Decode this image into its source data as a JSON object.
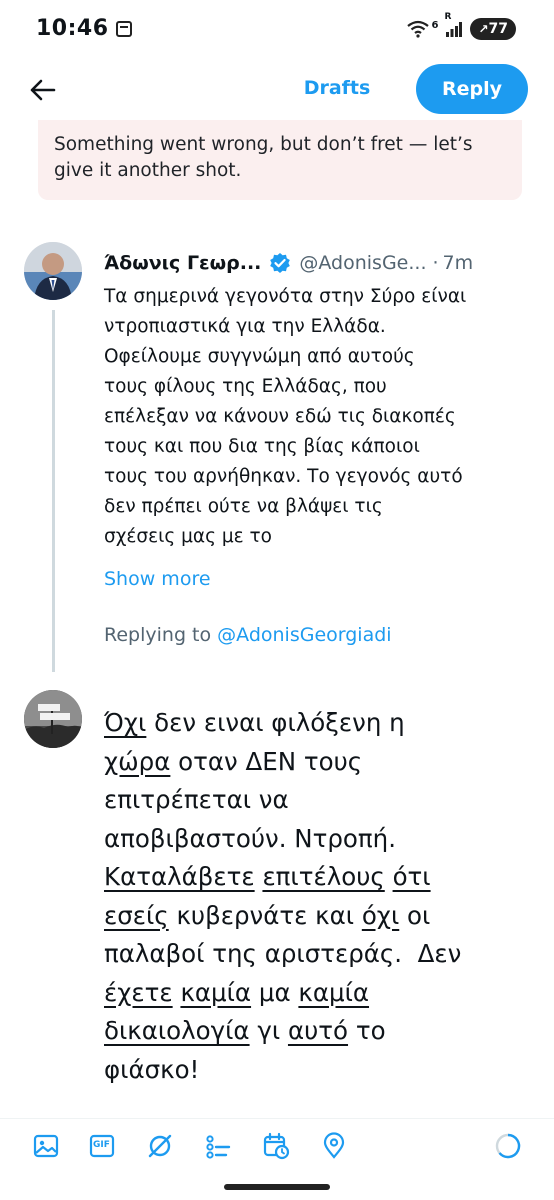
{
  "status_bar": {
    "time": "10:46",
    "battery": "77",
    "network": "6",
    "roaming": "R"
  },
  "top_bar": {
    "drafts_label": "Drafts",
    "reply_label": "Reply"
  },
  "error_banner": {
    "text": "Something went wrong, but don’t fret — let’s give it another shot."
  },
  "tweet": {
    "author_name": "Άδωνις Γεωρ...",
    "handle": "@AdonisGe...",
    "separator": "·",
    "time": "7m",
    "lines": [
      "Τα σημερινά γεγονότα στην Σύρο είναι",
      "ντροπιαστικά για την Ελλάδα.",
      "Οφείλουμε συγγνώμη από αυτούς",
      "τους φίλους της Ελλάδας, που",
      "επέλεξαν να κάνουν εδώ τις διακοπές",
      "τους και που δια της βίας κάποιοι",
      "τους του αρνήθηκαν. Το γεγονός αυτό",
      "δεν πρέπει ούτε να βλάψει τις",
      "σχέσεις μας με το"
    ],
    "show_more": "Show more",
    "replying_prefix": "Replying to ",
    "replying_handle": "@AdonisGeorgiadi"
  },
  "compose": {
    "lines": [
      [
        {
          "t": "Όχι",
          "u": true
        },
        {
          "t": " δεν ειναι φιλόξενη η",
          "u": false
        }
      ],
      [
        {
          "t": "χώρα",
          "u": true
        },
        {
          "t": " οταν ΔΕΝ τους",
          "u": false
        }
      ],
      [
        {
          "t": "επιτρέπεται να",
          "u": false
        }
      ],
      [
        {
          "t": "αποβιβαστούν. Ντροπή.",
          "u": false
        }
      ],
      [
        {
          "t": "Καταλάβετε",
          "u": true
        },
        {
          "t": " ",
          "u": false
        },
        {
          "t": "επιτέλους",
          "u": true
        },
        {
          "t": " ",
          "u": false
        },
        {
          "t": "ότι",
          "u": true
        }
      ],
      [
        {
          "t": "εσείς",
          "u": true
        },
        {
          "t": " κυβερνάτε και ",
          "u": false
        },
        {
          "t": "όχι",
          "u": true
        },
        {
          "t": " οι",
          "u": false
        }
      ],
      [
        {
          "t": "παλαβοί της αριστεράς.  Δεν",
          "u": false
        }
      ],
      [
        {
          "t": "έχετε",
          "u": true
        },
        {
          "t": " ",
          "u": false
        },
        {
          "t": "καμία",
          "u": true
        },
        {
          "t": " μα ",
          "u": false
        },
        {
          "t": "καμία",
          "u": true
        }
      ],
      [
        {
          "t": "δικαιολογία",
          "u": true
        },
        {
          "t": " γι ",
          "u": false
        },
        {
          "t": "αυτό",
          "u": true
        },
        {
          "t": " το",
          "u": false
        }
      ],
      [
        {
          "t": "φιάσκο!",
          "u": false
        }
      ]
    ]
  },
  "toolbar": {
    "icons": [
      "image-icon",
      "gif-icon",
      "grok-icon",
      "poll-icon",
      "schedule-icon",
      "location-icon"
    ],
    "gif_label": "GIF"
  },
  "colors": {
    "accent": "#1d9bf0",
    "error_bg": "#fbefef",
    "muted": "#536471"
  }
}
